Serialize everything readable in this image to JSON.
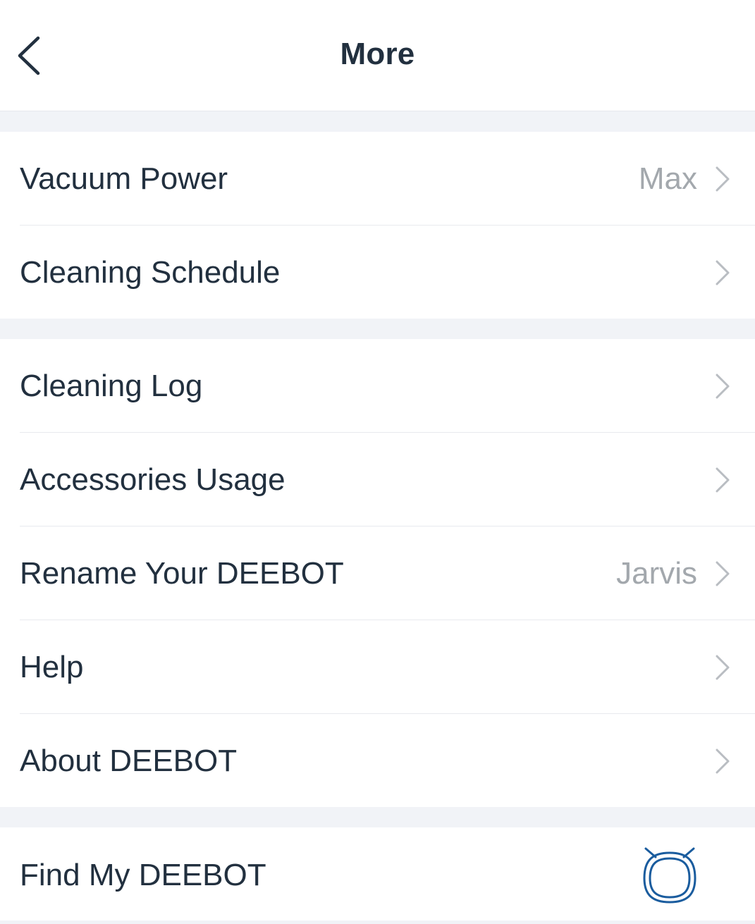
{
  "header": {
    "title": "More",
    "back_icon": "chevron-left-icon"
  },
  "settings": {
    "vacuum_power": {
      "label": "Vacuum Power",
      "value": "Max"
    },
    "cleaning_schedule": {
      "label": "Cleaning Schedule"
    }
  },
  "records": {
    "cleaning_log": {
      "label": "Cleaning Log"
    },
    "accessories_usage": {
      "label": "Accessories Usage"
    },
    "rename": {
      "label": "Rename Your DEEBOT",
      "value": "Jarvis"
    },
    "help": {
      "label": "Help"
    },
    "about": {
      "label": "About DEEBOT"
    }
  },
  "find": {
    "label": "Find My DEEBOT",
    "icon": "robot-icon",
    "icon_color": "#1a5c9e"
  },
  "colors": {
    "text": "#22303f",
    "secondary_text": "#a3a8ad",
    "chevron": "#b9bdc2",
    "background": "#f1f3f7"
  }
}
